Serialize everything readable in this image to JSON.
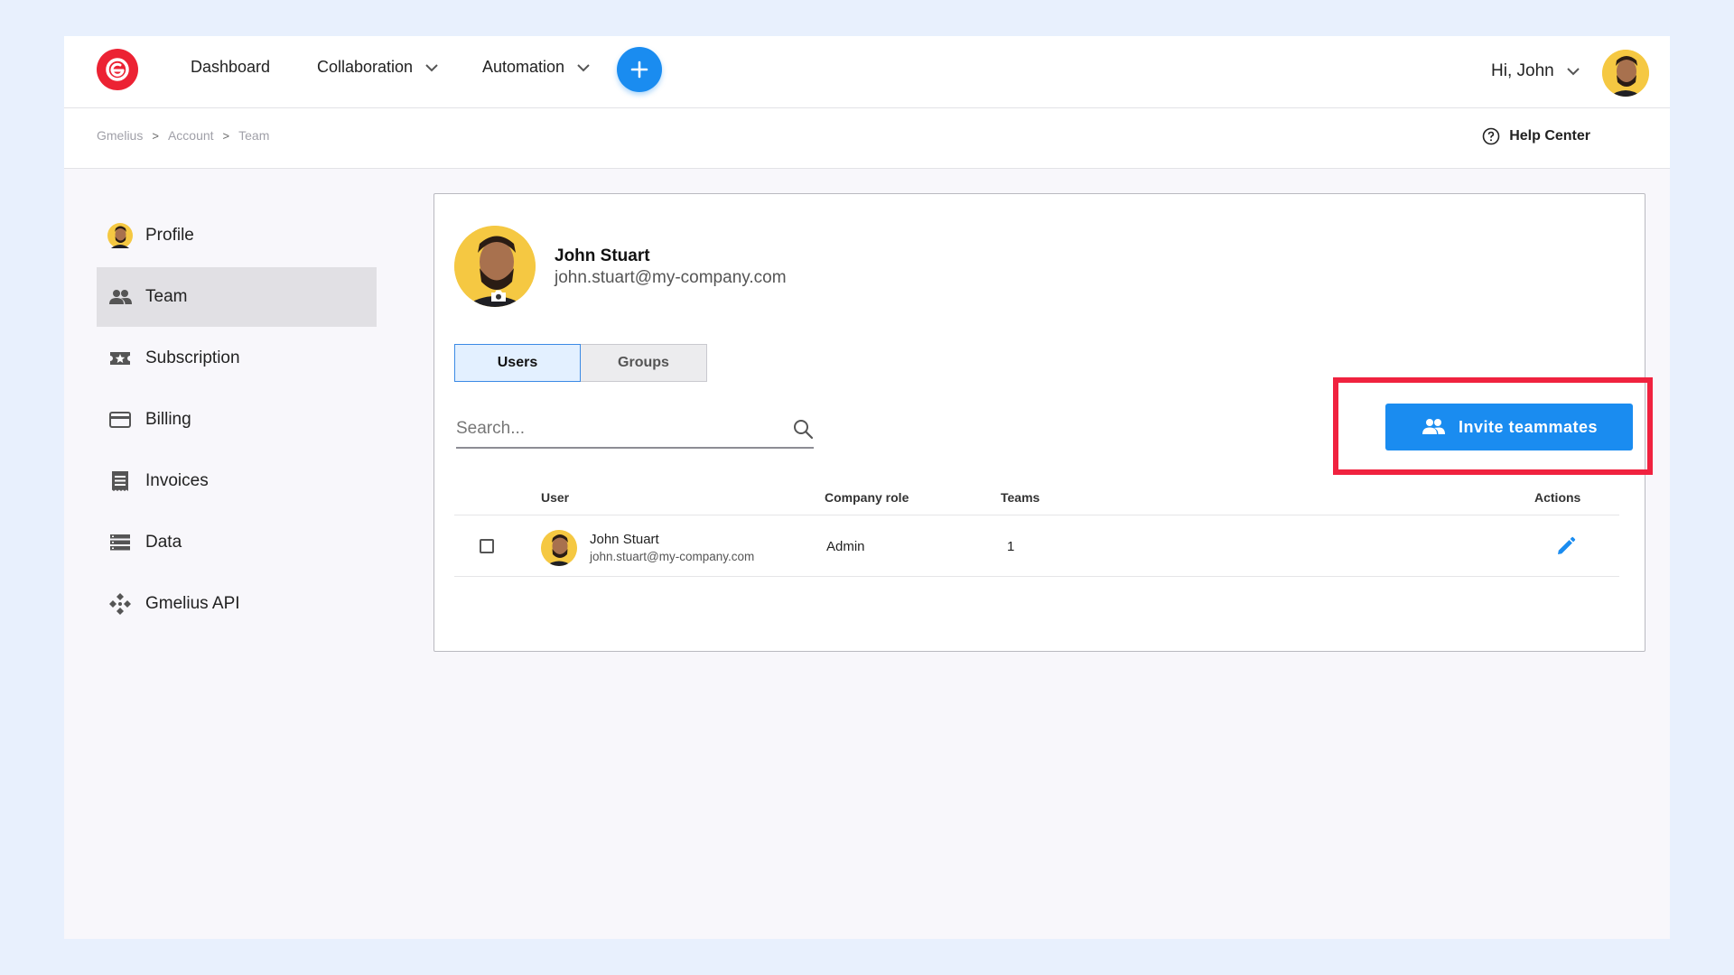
{
  "nav": {
    "items": [
      {
        "label": "Dashboard"
      },
      {
        "label": "Collaboration"
      },
      {
        "label": "Automation"
      }
    ],
    "greeting": "Hi, John"
  },
  "breadcrumb": {
    "items": [
      "Gmelius",
      "Account",
      "Team"
    ],
    "separator": ">"
  },
  "help": {
    "label": "Help Center"
  },
  "sidebar": {
    "items": [
      {
        "label": "Profile",
        "icon": "avatar"
      },
      {
        "label": "Team",
        "icon": "people-icon"
      },
      {
        "label": "Subscription",
        "icon": "ticket-star-icon"
      },
      {
        "label": "Billing",
        "icon": "credit-card-icon"
      },
      {
        "label": "Invoices",
        "icon": "receipt-icon"
      },
      {
        "label": "Data",
        "icon": "storage-icon"
      },
      {
        "label": "Gmelius API",
        "icon": "api-icon"
      }
    ]
  },
  "profile": {
    "name": "John Stuart",
    "email": "john.stuart@my-company.com"
  },
  "tabs": [
    {
      "label": "Users"
    },
    {
      "label": "Groups"
    }
  ],
  "search": {
    "placeholder": "Search..."
  },
  "invite": {
    "label": "Invite teammates"
  },
  "table": {
    "headers": {
      "user": "User",
      "role": "Company role",
      "teams": "Teams",
      "actions": "Actions"
    },
    "rows": [
      {
        "name": "John Stuart",
        "email": "john.stuart@my-company.com",
        "role": "Admin",
        "teams": "1"
      }
    ]
  },
  "colors": {
    "accent": "#1a8cf0",
    "brand": "#ec2233",
    "highlight": "#f0223f",
    "avatar_bg": "#f5c842"
  }
}
